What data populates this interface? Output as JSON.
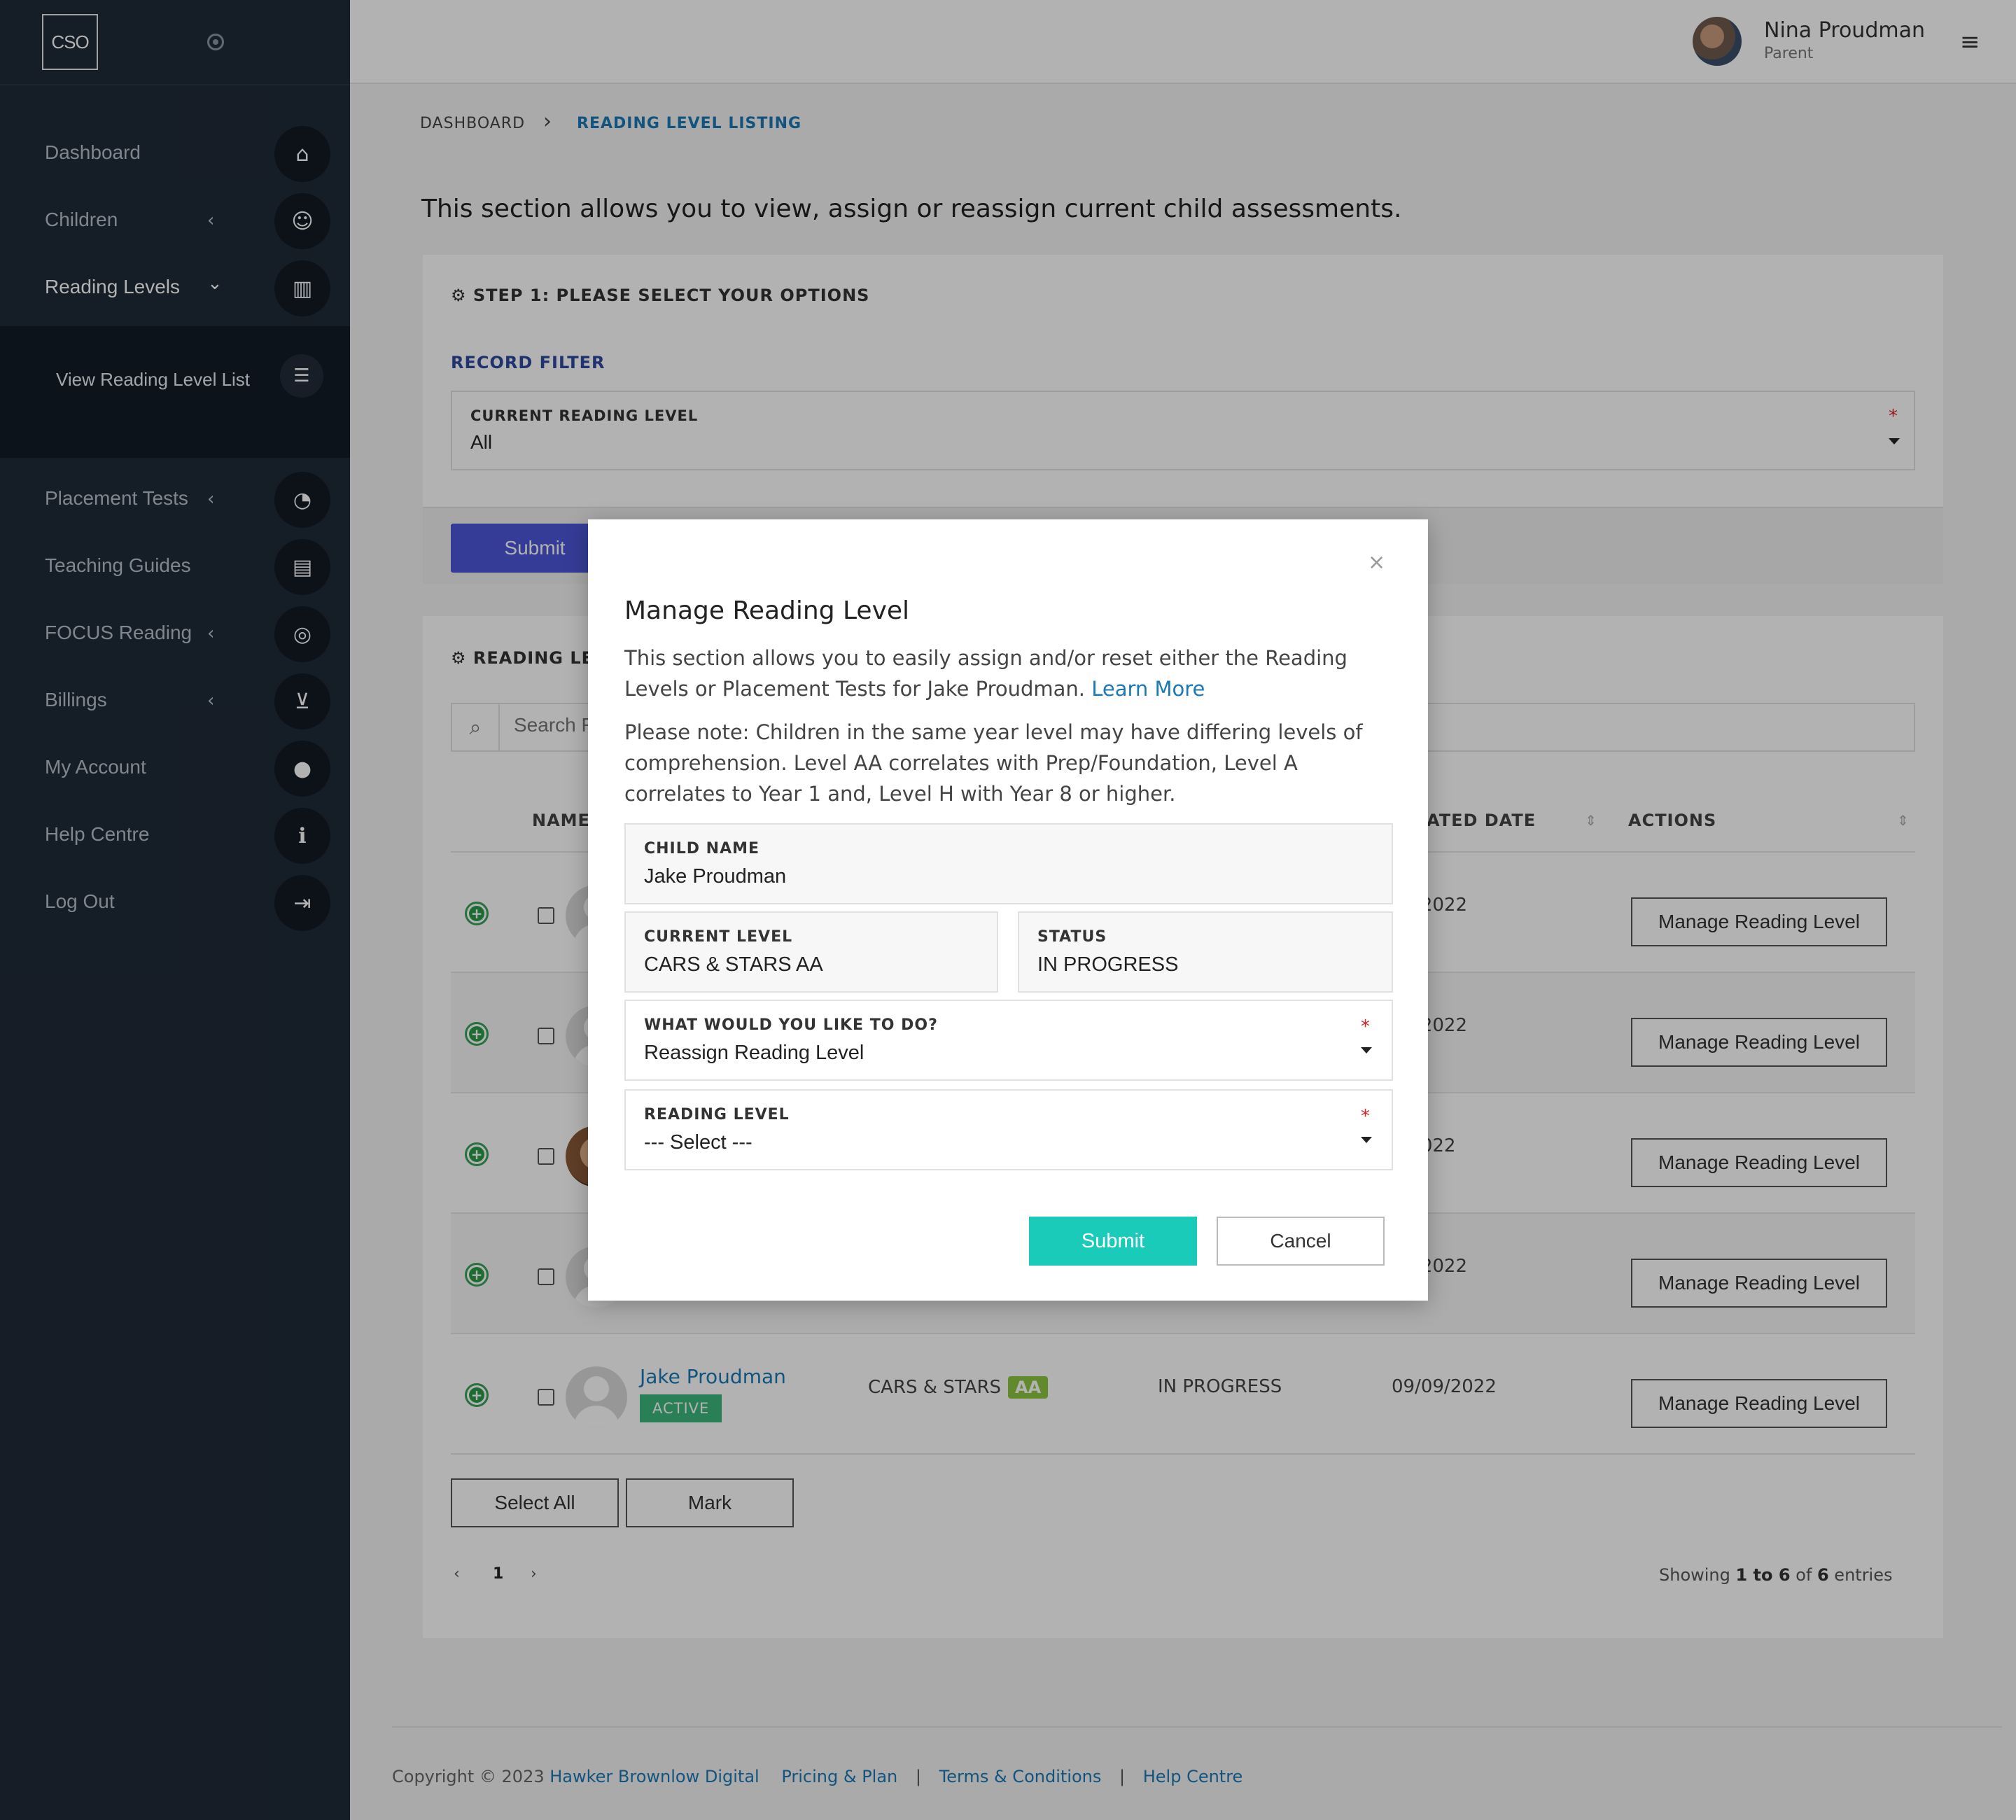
{
  "sidebar": {
    "logo": "CSO",
    "items": [
      {
        "label": "Dashboard",
        "icon": "home-icon"
      },
      {
        "label": "Children",
        "icon": "child-icon"
      },
      {
        "label": "Reading Levels",
        "icon": "book-icon"
      },
      {
        "label": "Placement Tests",
        "icon": "gauge-icon"
      },
      {
        "label": "Teaching Guides",
        "icon": "library-icon"
      },
      {
        "label": "FOCUS Reading",
        "icon": "target-icon"
      },
      {
        "label": "Billings",
        "icon": "cart-icon"
      },
      {
        "label": "My Account",
        "icon": "user-icon"
      },
      {
        "label": "Help Centre",
        "icon": "info-icon"
      },
      {
        "label": "Log Out",
        "icon": "logout-icon"
      }
    ],
    "sub_item": {
      "label": "View Reading Level List",
      "icon": "list-icon"
    }
  },
  "topbar": {
    "user_name": "Nina Proudman",
    "user_role": "Parent"
  },
  "breadcrumb": {
    "home": "DASHBOARD",
    "current": "READING LEVEL LISTING"
  },
  "intro": "This section allows you to view, assign or reassign current child assessments.",
  "step1": {
    "title": "STEP 1: PLEASE SELECT YOUR OPTIONS",
    "filter_title": "RECORD FILTER",
    "level_label": "CURRENT READING LEVEL",
    "level_value": "All",
    "submit": "Submit"
  },
  "listing": {
    "title": "READING LEV",
    "search_placeholder": "Search R",
    "columns": {
      "name": "NAME",
      "date": "ATED DATE",
      "actions": "ACTIONS"
    },
    "rows": [
      {
        "date": "05/2022",
        "action": "Manage Reading Level"
      },
      {
        "date": "05/2022",
        "action": "Manage Reading Level"
      },
      {
        "date": "0/2022",
        "action": "Manage Reading Level"
      },
      {
        "date": "02/2022",
        "action": "Manage Reading Level"
      },
      {
        "name": "Jake Proudman",
        "badge": "ACTIVE",
        "level": "CARS & STARS",
        "level_badge": "AA",
        "status": "IN PROGRESS",
        "date": "09/09/2022",
        "action": "Manage Reading Level"
      }
    ],
    "select_all": "Select All",
    "mark": "Mark",
    "pager": {
      "prev": "‹",
      "page": "1",
      "next": "›"
    },
    "showing": {
      "prefix": "Showing ",
      "from": "1",
      "to_word": " to ",
      "to": "6",
      "of_word": " of ",
      "total": "6",
      "suffix": " entries"
    }
  },
  "footer": {
    "copyright": "Copyright © 2023 ",
    "company": "Hawker Brownlow Digital",
    "links": [
      "Pricing & Plan",
      "Terms & Conditions",
      "Help Centre"
    ],
    "separator": "|"
  },
  "modal": {
    "title": "Manage Reading Level",
    "close": "×",
    "text1": "This section allows you to easily assign and/or reset either the Reading Levels or Placement Tests for Jake Proudman. ",
    "learn_more": "Learn More",
    "text2": "Please note: Children in the same year level may have differing levels of comprehension. Level AA correlates with Prep/Foundation, Level A correlates to Year 1 and, Level H with Year 8 or higher.",
    "child_name_label": "CHILD NAME",
    "child_name": "Jake Proudman",
    "current_level_label": "CURRENT LEVEL",
    "current_level": "CARS & STARS AA",
    "status_label": "STATUS",
    "status": "IN PROGRESS",
    "action_label": "WHAT WOULD YOU LIKE TO DO?",
    "action_value": "Reassign Reading Level",
    "reading_level_label": "READING LEVEL",
    "reading_level_value": "--- Select ---",
    "required_mark": "*",
    "submit": "Submit",
    "cancel": "Cancel"
  }
}
